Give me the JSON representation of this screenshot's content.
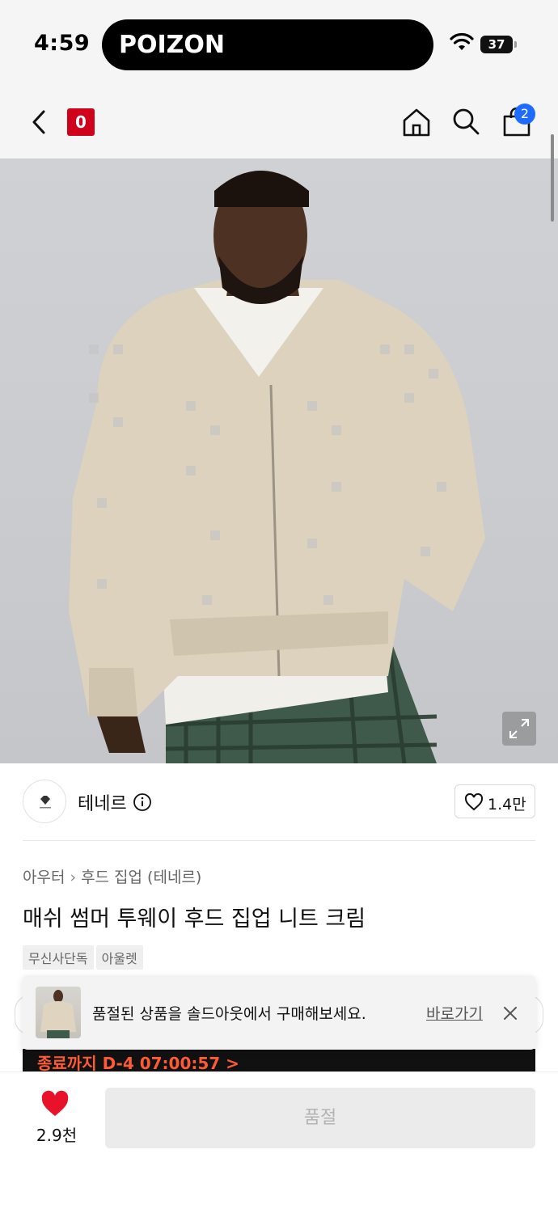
{
  "status_bar": {
    "time": "4:59",
    "island_app": "POIZON",
    "battery": "37"
  },
  "nav": {
    "brand_badge": "0",
    "cart_count": "2",
    "icons": [
      "back-icon",
      "home-icon",
      "search-icon",
      "cart-icon"
    ]
  },
  "product": {
    "brand": {
      "name": "테네르",
      "like_count": "1.4만"
    },
    "breadcrumb": [
      "아우터",
      "후드 집업 (테네르)"
    ],
    "title": "매쉬 썸머 투웨이 후드 집업 니트 크림",
    "tags": [
      "무신사단독",
      "아울렛"
    ]
  },
  "promo": {
    "text": "종료까지 D-4 07:00:57 >"
  },
  "toast": {
    "message": "품절된 상품을 솔드아웃에서 구매해보세요.",
    "link_label": "바로가기"
  },
  "bottom": {
    "wish_count": "2.9천",
    "soldout_label": "품절"
  },
  "colors": {
    "accent_red": "#d0021b",
    "badge_blue": "#1f6bff",
    "heart_red": "#e8132a",
    "disabled_gray": "#ebebeb"
  }
}
